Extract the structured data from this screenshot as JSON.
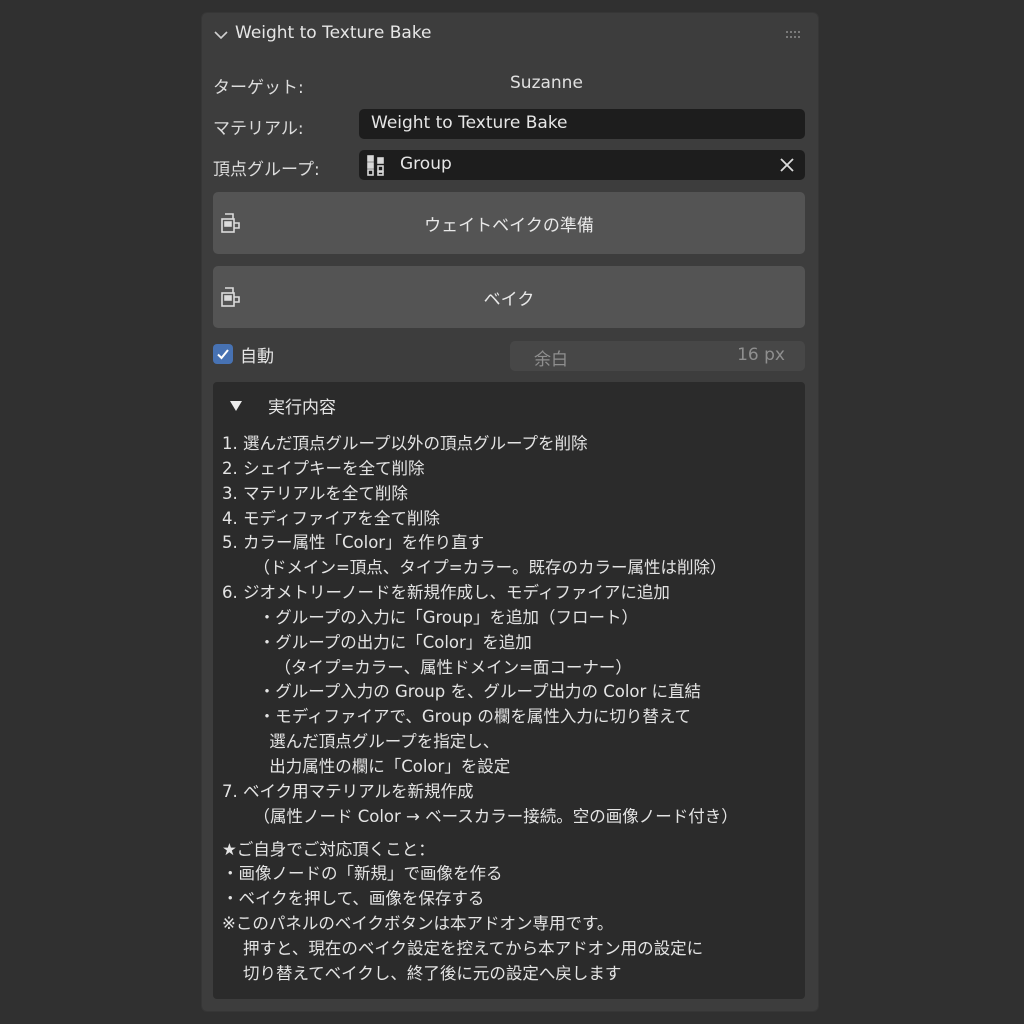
{
  "panel": {
    "title": "Weight to Texture Bake"
  },
  "target": {
    "label": "ターゲット:",
    "value": "Suzanne"
  },
  "material": {
    "label": "マテリアル:",
    "value": "Weight to Texture Bake"
  },
  "vertex_group": {
    "label": "頂点グループ:",
    "value": "Group"
  },
  "buttons": {
    "prepare": "ウェイトベイクの準備",
    "bake": "ベイク"
  },
  "auto": {
    "label": "自動",
    "checked": true
  },
  "padding": {
    "label": "余白",
    "value": "16 px"
  },
  "details": {
    "title": "実行内容",
    "lines": [
      "1. 選んだ頂点グループ以外の頂点グループを削除",
      "2. シェイプキーを全て削除",
      "3. マテリアルを全て削除",
      "4. モディファイアを全て削除",
      "5. カラー属性「Color」を作り直す",
      "      （ドメイン=頂点、タイプ=カラー。既存のカラー属性は削除）",
      "6. ジオメトリーノードを新規作成し、モディファイアに追加",
      "       ・グループの入力に「Group」を追加（フロート）",
      "       ・グループの出力に「Color」を追加",
      "          （タイプ=カラー、属性ドメイン=面コーナー）",
      "       ・グループ入力の Group を、グループ出力の Color に直結",
      "       ・モディファイアで、Group の欄を属性入力に切り替えて",
      "         選んだ頂点グループを指定し、",
      "         出力属性の欄に「Color」を設定",
      "7. ベイク用マテリアルを新規作成",
      "      （属性ノード Color → ベースカラー接続。空の画像ノード付き）",
      "",
      "★ご自身でご対応頂くこと：",
      "・画像ノードの「新規」で画像を作る",
      "・ベイクを押して、画像を保存する",
      "※このパネルのベイクボタンは本アドオン専用です。",
      "    押すと、現在のベイク設定を控えてから本アドオン用の設定に",
      "    切り替えてベイクし、終了後に元の設定へ戻します"
    ]
  }
}
